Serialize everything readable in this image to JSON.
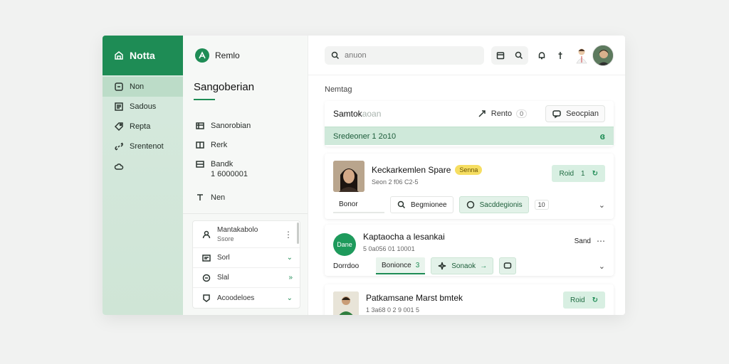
{
  "app": {
    "name": "Notta"
  },
  "rail": {
    "items": [
      {
        "label": "Non",
        "icon": "square-icon",
        "active": true
      },
      {
        "label": "Sadous",
        "icon": "document-icon",
        "active": false
      },
      {
        "label": "Repta",
        "icon": "tag-icon",
        "active": false
      },
      {
        "label": "Srentenot",
        "icon": "link-icon",
        "active": false
      },
      {
        "label": "",
        "icon": "cloud-icon",
        "active": false
      }
    ]
  },
  "mid": {
    "brand": "Remlo",
    "title": "Sangoberian",
    "nav": [
      {
        "label": "Sanorobian",
        "icon": "table-icon"
      },
      {
        "label": "Rerk",
        "icon": "grid-icon"
      },
      {
        "label": "Bandk",
        "icon": "grid-icon",
        "sub": "1 6000001"
      },
      {
        "label": "Nen",
        "icon": "text-icon"
      }
    ],
    "card": {
      "rows": [
        {
          "label": "Mantakabolo",
          "sub": "Ssore",
          "icon": "user-icon",
          "trail": "⋮"
        },
        {
          "label": "Sorl",
          "icon": "document-icon",
          "trail": "⌄"
        },
        {
          "label": "Slal",
          "icon": "chat-icon",
          "trail": "»"
        },
        {
          "label": "Acoodeloes",
          "icon": "tag-icon",
          "trail": "⌄"
        }
      ]
    }
  },
  "topbar": {
    "search_placeholder": "anuon"
  },
  "main": {
    "section_label": "Nemtag",
    "tabs": {
      "active": "Samtok",
      "faint": "aoan",
      "right_label": "Rento",
      "right_badge": "0",
      "button": "Seocpian"
    },
    "highlight": {
      "text": "Sredeoner 1 2o10",
      "tag": "ɞ"
    },
    "items": [
      {
        "title": "Keckarkemlen Spare",
        "badge": "Senna",
        "sub": "Seon 2 f06 C2-5",
        "button": "Roid",
        "button_count": "1",
        "actions": [
          "Bonor",
          "Begmionee",
          "Sacddegionis"
        ],
        "chip": "10"
      },
      {
        "avatar_text": "Dane",
        "title": "Kaptaocha a lesankai",
        "sub": "5 0a056 01 10001",
        "right_label": "Sand",
        "actions_label": "Dorrdoo",
        "actions": [
          "Bonionce",
          "Sonaok"
        ],
        "action_count": "3"
      },
      {
        "title": "Patkamsane Marst bmtek",
        "sub": "1 3a68 0 2 9 001 5",
        "button": "Roid"
      }
    ]
  }
}
